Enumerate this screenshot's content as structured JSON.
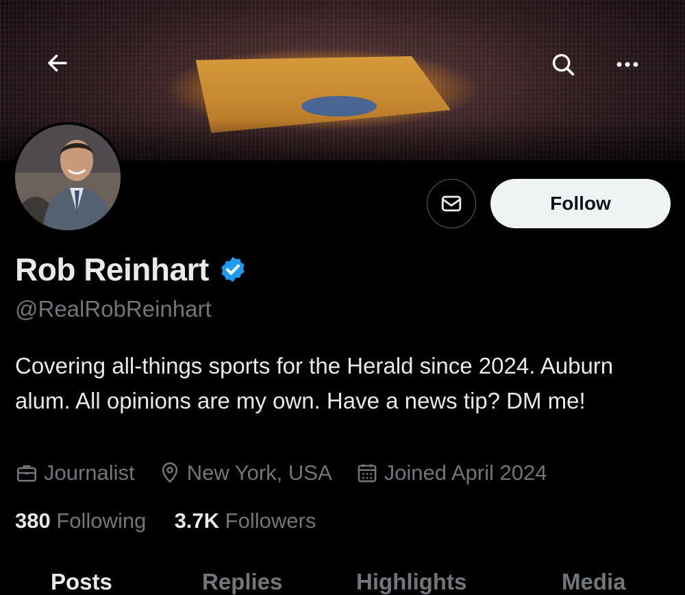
{
  "header": {
    "back_icon": "arrow-left-icon",
    "search_icon": "search-icon",
    "more_icon": "more-horizontal-icon"
  },
  "profile": {
    "name": "Rob Reinhart",
    "verified": true,
    "verified_color": "#1d9bf0",
    "handle": "@RealRobReinhart",
    "bio": "Covering all-things sports for the Herald since 2024. Auburn alum. All opinions are my own. Have a news tip? DM me!",
    "profession": "Journalist",
    "location": "New York, USA",
    "joined": "Joined April 2024"
  },
  "actions": {
    "message_icon": "mail-icon",
    "follow_label": "Follow"
  },
  "stats": {
    "following_count": "380",
    "following_label": "Following",
    "followers_count": "3.7K",
    "followers_label": "Followers"
  },
  "tabs": [
    {
      "label": "Posts",
      "active": true
    },
    {
      "label": "Replies",
      "active": false
    },
    {
      "label": "Highlights",
      "active": false
    },
    {
      "label": "Media",
      "active": false
    }
  ],
  "colors": {
    "background": "#000000",
    "text_primary": "#e7e9ea",
    "text_secondary": "#71767b",
    "follow_button_bg": "#eff3f4"
  }
}
